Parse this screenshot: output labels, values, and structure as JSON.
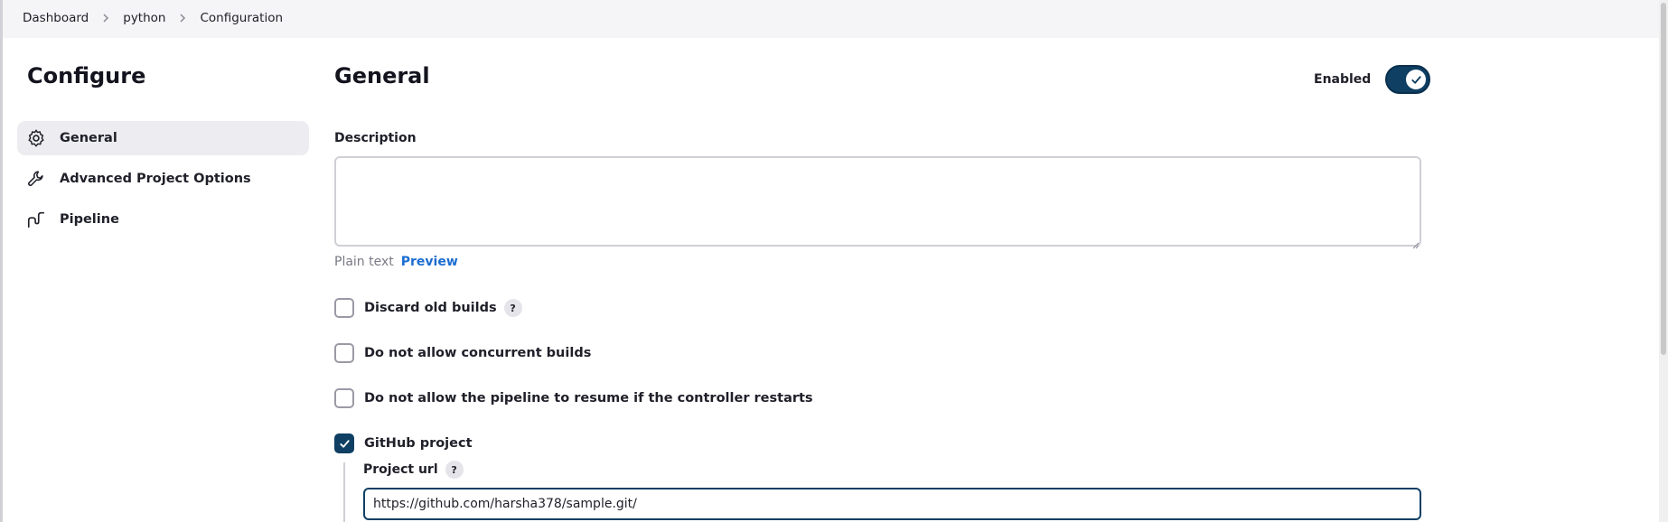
{
  "breadcrumb": {
    "items": [
      "Dashboard",
      "python",
      "Configuration"
    ]
  },
  "sidebar": {
    "title": "Configure",
    "items": [
      {
        "label": "General",
        "icon": "gear-icon",
        "active": true
      },
      {
        "label": "Advanced Project Options",
        "icon": "wrench-icon",
        "active": false
      },
      {
        "label": "Pipeline",
        "icon": "pipeline-icon",
        "active": false
      }
    ]
  },
  "main": {
    "section_title": "General",
    "enabled_label": "Enabled",
    "enabled": true,
    "description_label": "Description",
    "description_value": "",
    "format_plain": "Plain text",
    "format_preview": "Preview",
    "options": [
      {
        "label": "Discard old builds",
        "checked": false,
        "has_help": true
      },
      {
        "label": "Do not allow concurrent builds",
        "checked": false,
        "has_help": false
      },
      {
        "label": "Do not allow the pipeline to resume if the controller restarts",
        "checked": false,
        "has_help": false
      },
      {
        "label": "GitHub project",
        "checked": true,
        "has_help": false
      }
    ],
    "project_url_label": "Project url",
    "project_url_value": "https://github.com/harsha378/sample.git/",
    "help_glyph": "?"
  },
  "colors": {
    "accent": "#0f3f63",
    "link": "#1c6dd0",
    "active_bg": "#ececf1"
  }
}
